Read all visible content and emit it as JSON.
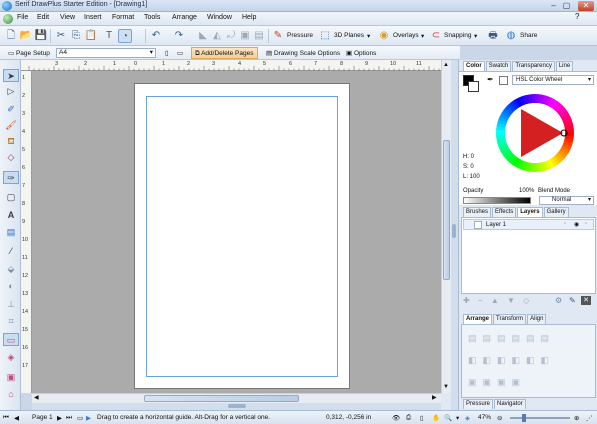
{
  "window": {
    "title": "Serif DrawPlus Starter Edition - [Drawing1]",
    "controls": [
      "–",
      "▢",
      "✕"
    ]
  },
  "menubar": [
    "File",
    "Edit",
    "View",
    "Insert",
    "Format",
    "Tools",
    "Arrange",
    "Window",
    "Help"
  ],
  "toolbar": {
    "pressure": "Pressure",
    "planes3d": "3D Planes",
    "overlays": "Overlays",
    "snapping": "Snapping",
    "share": "Share"
  },
  "contextbar": {
    "page_setup": "Page Setup",
    "page_size": "A4",
    "add_delete_pages": "Add/Delete Pages",
    "drawing_scale": "Drawing Scale Options",
    "options": "Options"
  },
  "ruler": {
    "h_ticks": [
      "3",
      "2",
      "1",
      "0",
      "1",
      "2",
      "3",
      "4",
      "5",
      "6",
      "7",
      "8",
      "9",
      "10",
      "11"
    ],
    "v_ticks": [
      "1",
      "2",
      "3",
      "4",
      "5",
      "6",
      "7",
      "8",
      "9",
      "10",
      "11",
      "12",
      "13",
      "14",
      "15",
      "16",
      "17"
    ]
  },
  "color_panel": {
    "tabs": [
      "Color",
      "Swatch",
      "Transparency",
      "Line"
    ],
    "active_tab": "Color",
    "mode": "HSL Color Wheel",
    "h": "H: 0",
    "s": "S: 0",
    "l": "L: 100",
    "opacity_label": "Opacity",
    "opacity_value": "100%",
    "blend_mode_label": "Blend Mode",
    "blend_mode": "Normal"
  },
  "layers_panel": {
    "tabs": [
      "Brushes",
      "Effects",
      "Layers",
      "Gallery"
    ],
    "active_tab": "Layers",
    "layer_name": "Layer 1"
  },
  "arrange_panel": {
    "tabs": [
      "Arrange",
      "Transform",
      "Align"
    ],
    "active_tab": "Arrange"
  },
  "bottom_panel": {
    "tabs": [
      "Pressure",
      "Navigator"
    ]
  },
  "statusbar": {
    "page": "Page 1",
    "hint": "Drag to create a horizontal guide. Alt-Drag for a vertical one.",
    "coords": "0,312, -0,256 in",
    "zoom": "47%"
  },
  "colors": {
    "accent": "#3f78c8",
    "margin_guide": "#6ea0e0",
    "pasteboard": "#ababab"
  }
}
